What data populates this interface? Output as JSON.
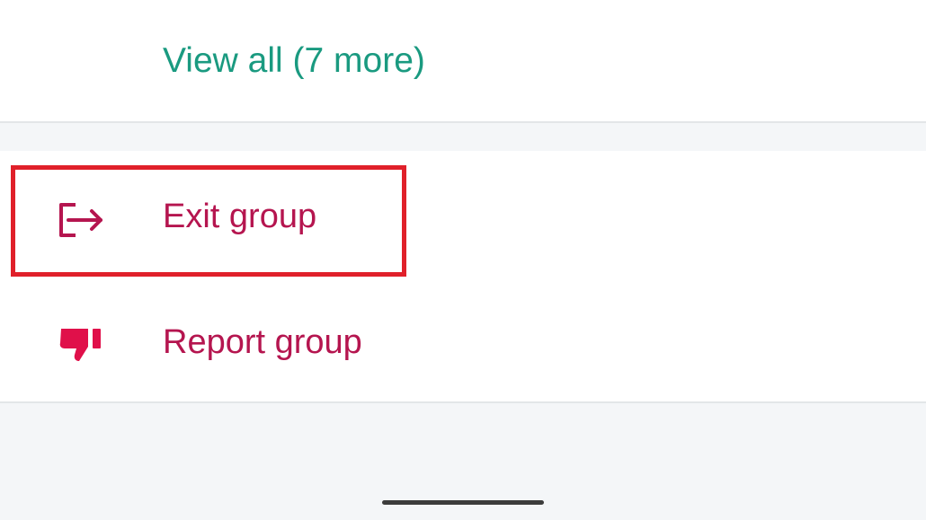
{
  "participants": {
    "view_all_label": "View all (7 more)",
    "link_color": "#1a9a80"
  },
  "actions": {
    "exit": {
      "label": "Exit group",
      "icon": "exit-icon"
    },
    "report": {
      "label": "Report group",
      "icon": "thumbs-down-icon"
    },
    "danger_color": "#b5154f"
  },
  "annotation": {
    "highlight_color": "#e0202a",
    "highlighted_item": "Exit group"
  }
}
